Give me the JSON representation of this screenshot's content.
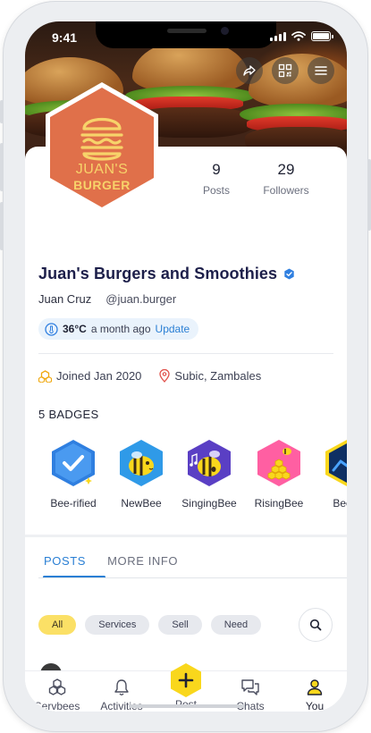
{
  "status_bar": {
    "time": "9:41"
  },
  "profile": {
    "logo_line1": "JUAN'S",
    "logo_line2": "BURGER",
    "name": "Juan's Burgers and Smoothies",
    "owner": "Juan Cruz",
    "handle": "@juan.burger",
    "weather": {
      "temp": "36°C",
      "ago": "a month ago",
      "update_label": "Update"
    },
    "joined": "Joined Jan 2020",
    "location": "Subic, Zambales"
  },
  "stats": [
    {
      "value": "9",
      "label": "Posts"
    },
    {
      "value": "29",
      "label": "Followers"
    }
  ],
  "badges": {
    "title": "5 BADGES",
    "items": [
      {
        "label": "Bee-rified",
        "icon": "check-badge-icon",
        "color": "#2f7fe0"
      },
      {
        "label": "NewBee",
        "icon": "new-bee-badge-icon",
        "color": "#2f9ae8"
      },
      {
        "label": "SingingBee",
        "icon": "singing-bee-badge-icon",
        "color": "#5a3fc4"
      },
      {
        "label": "RisingBee",
        "icon": "rising-bee-badge-icon",
        "color": "#ff5fa2"
      },
      {
        "label": "Bee-k",
        "icon": "chart-badge-icon",
        "color": "#0e2f63"
      }
    ]
  },
  "tabs": [
    {
      "label": "POSTS",
      "active": true
    },
    {
      "label": "MORE INFO",
      "active": false
    }
  ],
  "filters": [
    {
      "label": "All",
      "active": true
    },
    {
      "label": "Services",
      "active": false
    },
    {
      "label": "Sell",
      "active": false
    },
    {
      "label": "Need",
      "active": false
    }
  ],
  "bottom_nav": [
    {
      "label": "Servbees",
      "icon": "servbees-icon"
    },
    {
      "label": "Activities",
      "icon": "bell-icon"
    },
    {
      "label": "Post",
      "icon": "plus-icon"
    },
    {
      "label": "Chats",
      "icon": "chat-icon"
    },
    {
      "label": "You",
      "icon": "user-icon",
      "active": true
    }
  ],
  "colors": {
    "accent_blue": "#2a7fd4",
    "logo_orange": "#e0704a",
    "logo_yellow": "#f7d36a",
    "chip_active": "#fbe066",
    "post_yellow": "#f9d71c"
  }
}
